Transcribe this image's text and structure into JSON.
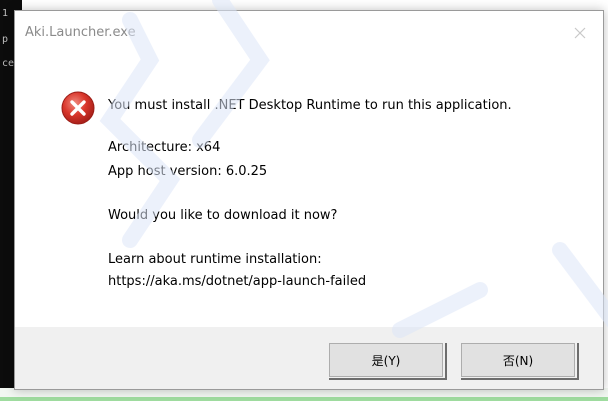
{
  "dialog": {
    "title": "Aki.Launcher.exe",
    "messages": {
      "main": "You must install .NET Desktop Runtime to run this application.",
      "architecture": "Architecture: x64",
      "host_version": "App host version: 6.0.25",
      "question": "Would you like to download it now?",
      "learn_about": "Learn about runtime installation:",
      "url": "https://aka.ms/dotnet/app-launch-failed"
    },
    "buttons": {
      "yes": "是(Y)",
      "no": "否(N)"
    },
    "icon": "error-icon",
    "close_icon": "close-icon"
  },
  "background_console": {
    "lines": [
      "1",
      "p",
      "ce"
    ]
  },
  "colors": {
    "error_red": "#d9362b",
    "footer_bg": "#f0f0f0",
    "button_bg": "#e1e1e1",
    "title_text": "#8a8a8a",
    "taskbar_accent": "#9fdc9f"
  }
}
